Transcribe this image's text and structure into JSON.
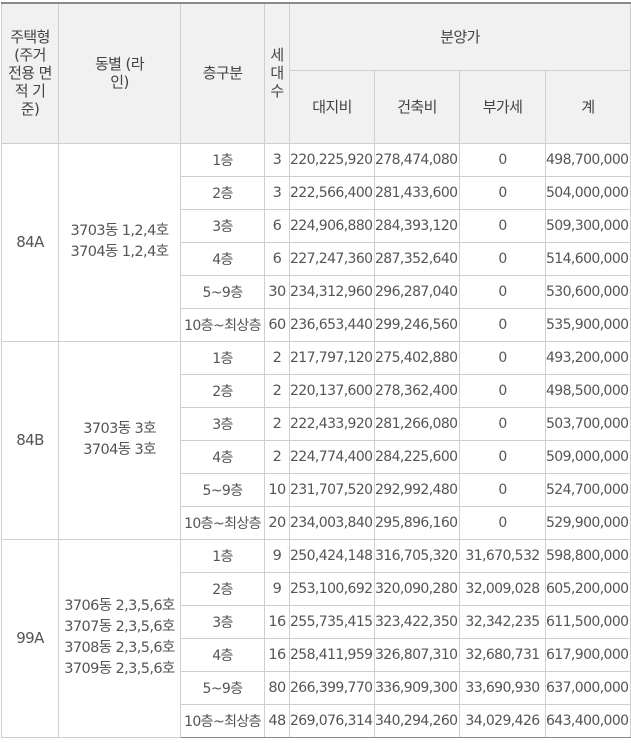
{
  "headers": {
    "type": "주택형 (주거 전용 면적 기준)",
    "dong": "동별 (라인)",
    "floor": "층구분",
    "households": "세대수",
    "price": "분양가",
    "land": "대지비",
    "building": "건축비",
    "vat": "부가세",
    "total": "계"
  },
  "groups": [
    {
      "type": "84A",
      "dong": [
        "3703동 1,2,4호",
        "3704동 1,2,4호"
      ],
      "rows": [
        {
          "floor": "1층",
          "households": "3",
          "land": "220,225,920",
          "building": "278,474,080",
          "vat": "0",
          "total": "498,700,000"
        },
        {
          "floor": "2층",
          "households": "3",
          "land": "222,566,400",
          "building": "281,433,600",
          "vat": "0",
          "total": "504,000,000"
        },
        {
          "floor": "3층",
          "households": "6",
          "land": "224,906,880",
          "building": "284,393,120",
          "vat": "0",
          "total": "509,300,000"
        },
        {
          "floor": "4층",
          "households": "6",
          "land": "227,247,360",
          "building": "287,352,640",
          "vat": "0",
          "total": "514,600,000"
        },
        {
          "floor": "5~9층",
          "households": "30",
          "land": "234,312,960",
          "building": "296,287,040",
          "vat": "0",
          "total": "530,600,000"
        },
        {
          "floor": "10층~최상층",
          "households": "60",
          "land": "236,653,440",
          "building": "299,246,560",
          "vat": "0",
          "total": "535,900,000"
        }
      ]
    },
    {
      "type": "84B",
      "dong": [
        "3703동 3호",
        "3704동 3호"
      ],
      "rows": [
        {
          "floor": "1층",
          "households": "2",
          "land": "217,797,120",
          "building": "275,402,880",
          "vat": "0",
          "total": "493,200,000"
        },
        {
          "floor": "2층",
          "households": "2",
          "land": "220,137,600",
          "building": "278,362,400",
          "vat": "0",
          "total": "498,500,000"
        },
        {
          "floor": "3층",
          "households": "2",
          "land": "222,433,920",
          "building": "281,266,080",
          "vat": "0",
          "total": "503,700,000"
        },
        {
          "floor": "4층",
          "households": "2",
          "land": "224,774,400",
          "building": "284,225,600",
          "vat": "0",
          "total": "509,000,000"
        },
        {
          "floor": "5~9층",
          "households": "10",
          "land": "231,707,520",
          "building": "292,992,480",
          "vat": "0",
          "total": "524,700,000"
        },
        {
          "floor": "10층~최상층",
          "households": "20",
          "land": "234,003,840",
          "building": "295,896,160",
          "vat": "0",
          "total": "529,900,000"
        }
      ]
    },
    {
      "type": "99A",
      "dong": [
        "3706동 2,3,5,6호",
        "3707동 2,3,5,6호",
        "3708동 2,3,5,6호",
        "3709동 2,3,5,6호"
      ],
      "rows": [
        {
          "floor": "1층",
          "households": "9",
          "land": "250,424,148",
          "building": "316,705,320",
          "vat": "31,670,532",
          "total": "598,800,000"
        },
        {
          "floor": "2층",
          "households": "9",
          "land": "253,100,692",
          "building": "320,090,280",
          "vat": "32,009,028",
          "total": "605,200,000"
        },
        {
          "floor": "3층",
          "households": "16",
          "land": "255,735,415",
          "building": "323,422,350",
          "vat": "32,342,235",
          "total": "611,500,000"
        },
        {
          "floor": "4층",
          "households": "16",
          "land": "258,411,959",
          "building": "326,807,310",
          "vat": "32,680,731",
          "total": "617,900,000"
        },
        {
          "floor": "5~9층",
          "households": "80",
          "land": "266,399,770",
          "building": "336,909,300",
          "vat": "33,690,930",
          "total": "637,000,000"
        },
        {
          "floor": "10층~최상층",
          "households": "48",
          "land": "269,076,314",
          "building": "340,294,260",
          "vat": "34,029,426",
          "total": "643,400,000"
        }
      ]
    }
  ]
}
